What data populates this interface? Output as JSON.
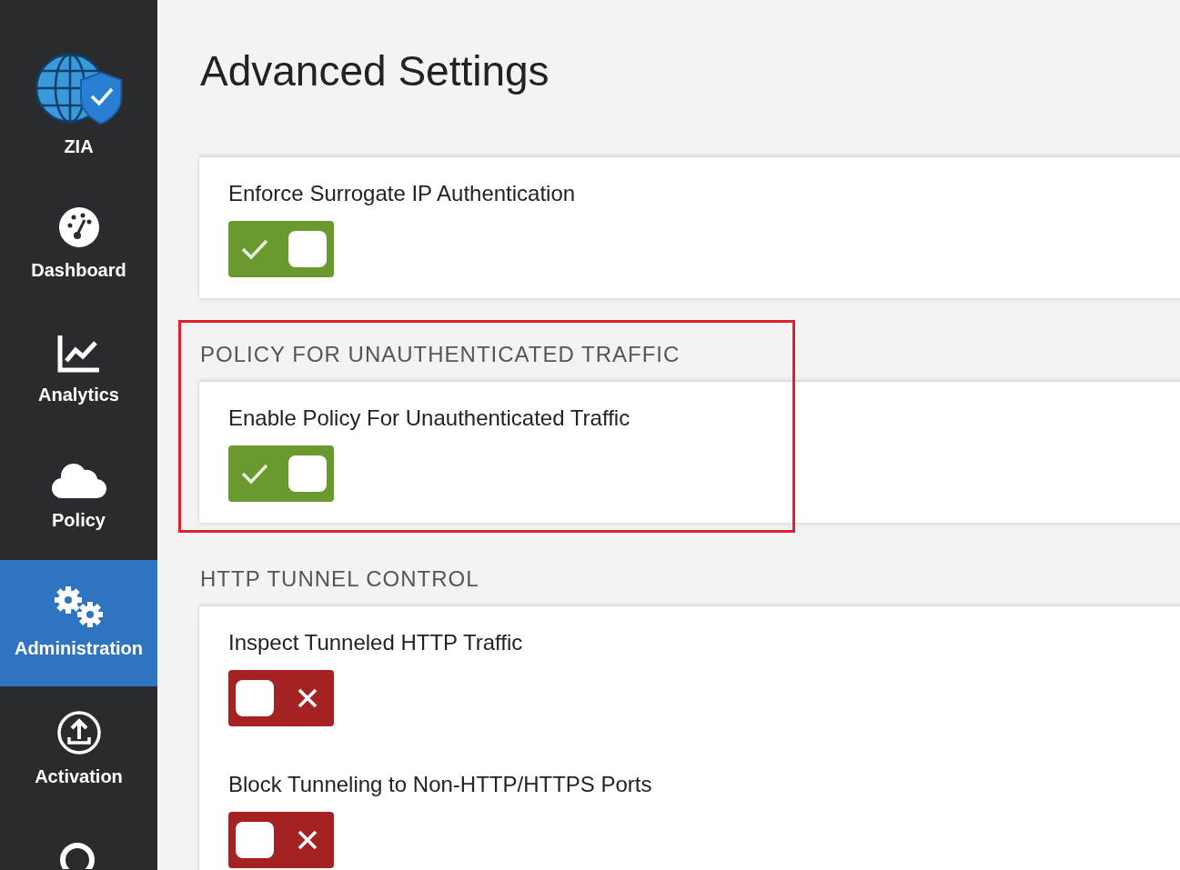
{
  "sidebar": {
    "logo_label": "ZIA",
    "items": [
      {
        "label": "Dashboard",
        "selected": false
      },
      {
        "label": "Analytics",
        "selected": false
      },
      {
        "label": "Policy",
        "selected": false
      },
      {
        "label": "Administration",
        "selected": true
      },
      {
        "label": "Activation",
        "selected": false
      }
    ]
  },
  "page": {
    "title": "Advanced Settings"
  },
  "sections": [
    {
      "settings": [
        {
          "label": "Enforce Surrogate IP Authentication",
          "on": true
        }
      ],
      "highlighted": false
    },
    {
      "header": "POLICY FOR UNAUTHENTICATED TRAFFIC",
      "settings": [
        {
          "label": "Enable Policy For Unauthenticated Traffic",
          "on": true
        }
      ],
      "highlighted": true
    },
    {
      "header": "HTTP TUNNEL CONTROL",
      "settings": [
        {
          "label": "Inspect Tunneled HTTP Traffic",
          "on": false
        },
        {
          "label": "Block Tunneling to Non-HTTP/HTTPS Ports",
          "on": false
        }
      ],
      "highlighted": false
    }
  ]
}
